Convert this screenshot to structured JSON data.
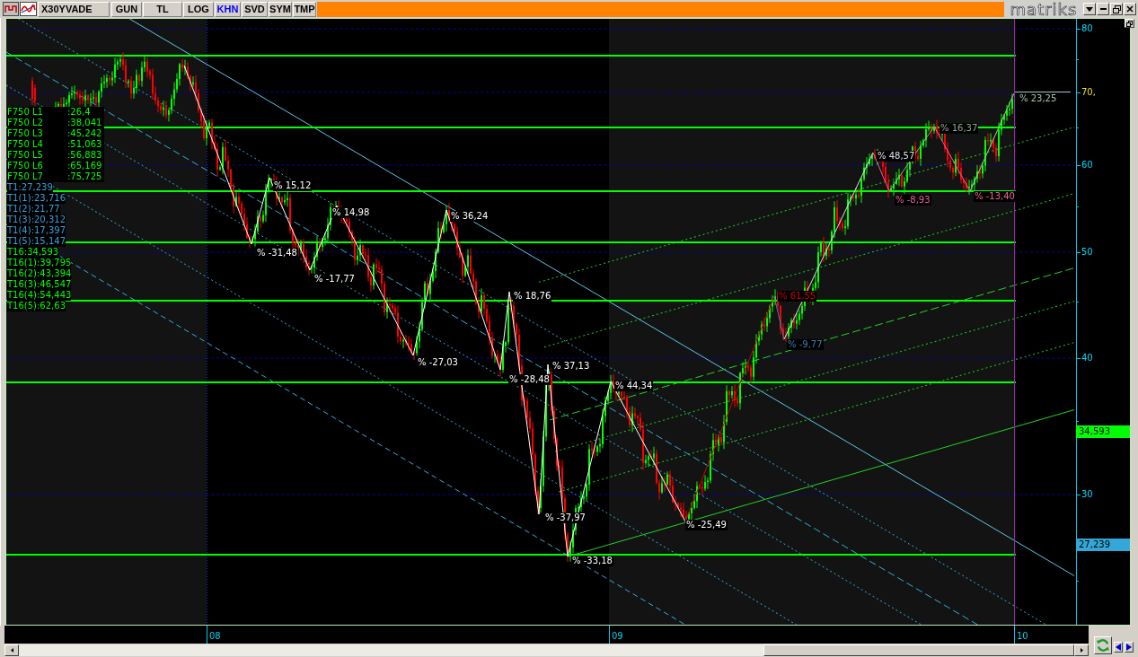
{
  "toolbar": {
    "symbol": "X30YVADE",
    "buttons": [
      {
        "label": "GUN",
        "selected": false
      },
      {
        "label": "TL",
        "selected": false
      },
      {
        "label": "LOG",
        "selected": false
      },
      {
        "label": "KHN",
        "selected": true
      },
      {
        "label": "SVD",
        "selected": false
      },
      {
        "label": "SYM",
        "selected": false
      },
      {
        "label": "TMP",
        "selected": false
      }
    ],
    "logo": "matriks"
  },
  "legend": {
    "fibonacci_levels": [
      {
        "label": "F750 L1",
        "value": ":26,4"
      },
      {
        "label": "F750 L2",
        "value": ":38,041"
      },
      {
        "label": "F750 L3",
        "value": ":45,242"
      },
      {
        "label": "F750 L4",
        "value": ":51,063"
      },
      {
        "label": "F750 L5",
        "value": ":56,883"
      },
      {
        "label": "F750 L6",
        "value": ":65,169"
      },
      {
        "label": "F750 L7",
        "value": ":75,725"
      }
    ],
    "t1_levels": [
      "T1:27,239",
      "T1(1):23,716",
      "T1(2):21,77",
      "T1(3):20,312",
      "T1(4):17,397",
      "T1(5):15,147"
    ],
    "t16_levels": [
      "T16:34,593",
      "T16(1):39,795",
      "T16(2):43,394",
      "T16(3):46,547",
      "T16(4):54,443",
      "T16(5):62,63"
    ]
  },
  "swings": [
    {
      "text": "% -31,48",
      "color": "#ffffff"
    },
    {
      "text": "% 15,12",
      "color": "#ffffff"
    },
    {
      "text": "% -17,77",
      "color": "#ffffff"
    },
    {
      "text": "% 14,98",
      "color": "#ffffff"
    },
    {
      "text": "% -27,03",
      "color": "#ffffff"
    },
    {
      "text": "% 36,24",
      "color": "#ffffff"
    },
    {
      "text": "% -28,48",
      "color": "#ffffff"
    },
    {
      "text": "% 18,76",
      "color": "#ffffff"
    },
    {
      "text": "% -37,97",
      "color": "#ffffff"
    },
    {
      "text": "% 37,13",
      "color": "#ffffff"
    },
    {
      "text": "% -33,18",
      "color": "#ffffff"
    },
    {
      "text": "% 44,34",
      "color": "#ffffff"
    },
    {
      "text": "% -25,49",
      "color": "#ffffff"
    },
    {
      "text": "% 61,55",
      "color": "#d00000"
    },
    {
      "text": "% -9,77",
      "color": "#3a80b8"
    },
    {
      "text": "% 48,57",
      "color": "#e0e0f0"
    },
    {
      "text": "% -8,93",
      "color": "#f0609a"
    },
    {
      "text": "% 16,37",
      "color": "#90a890"
    },
    {
      "text": "% -13,40",
      "color": "#f0609a"
    },
    {
      "text": "% 23,25",
      "color": "#a8c8a8"
    }
  ],
  "y_axis": {
    "ticks": [
      "80",
      "60",
      "50",
      "40",
      "30"
    ],
    "last_price": "70,",
    "price_tags": [
      {
        "text": "34,593",
        "color": "#00ff00"
      },
      {
        "text": "27,239",
        "color": "#33a8d8"
      }
    ]
  },
  "x_axis": {
    "labels": [
      "08",
      "09",
      "10"
    ]
  }
}
